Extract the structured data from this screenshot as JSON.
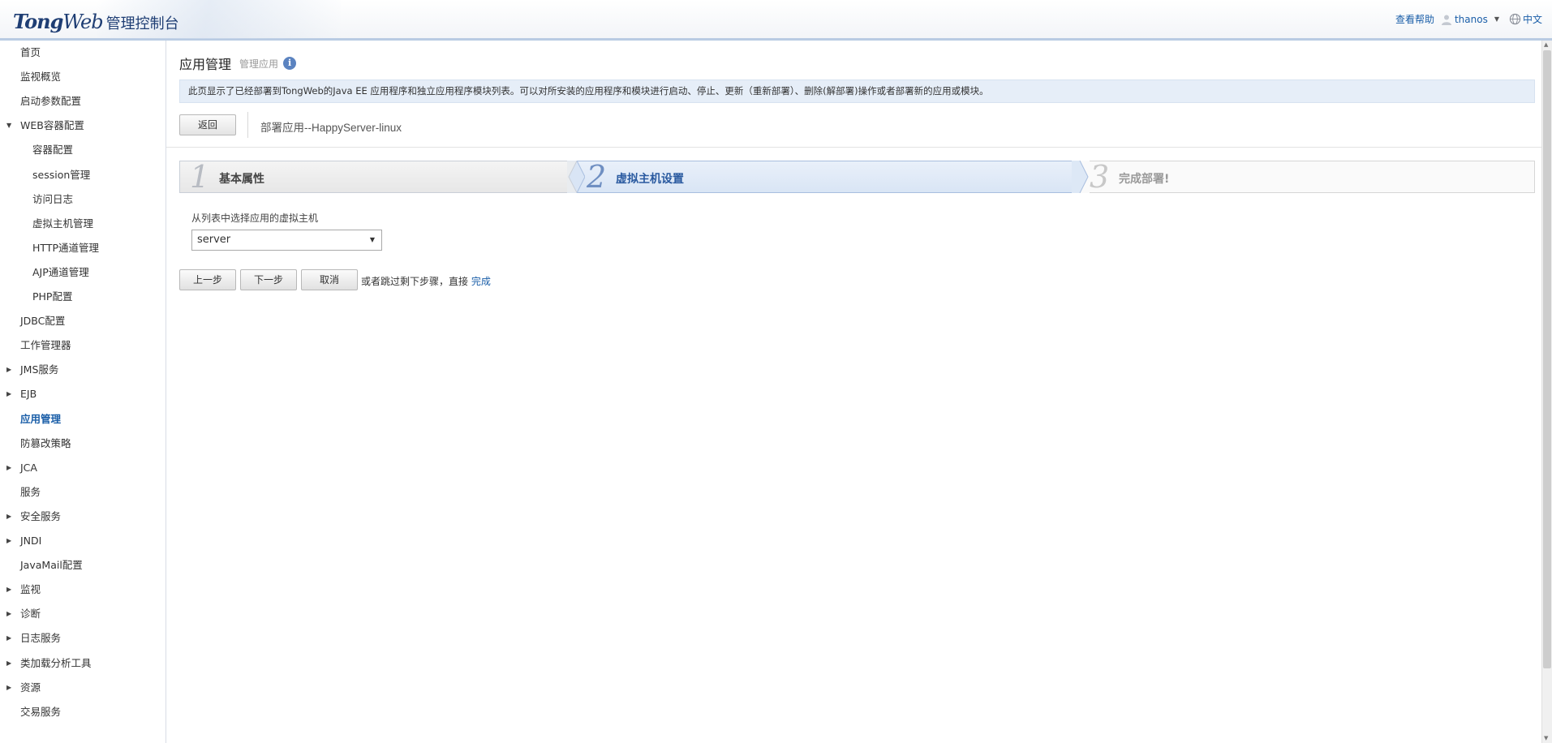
{
  "header": {
    "logo_brand_a": "Tong",
    "logo_brand_b": "Web",
    "logo_console": "管理控制台",
    "help": "查看帮助",
    "user": "thanos",
    "language": "中文"
  },
  "sidebar": {
    "items": [
      {
        "label": "首页",
        "level": 0,
        "expand": ""
      },
      {
        "label": "监视概览",
        "level": 0,
        "expand": ""
      },
      {
        "label": "启动参数配置",
        "level": 0,
        "expand": ""
      },
      {
        "label": "WEB容器配置",
        "level": 0,
        "expand": "▼"
      },
      {
        "label": "容器配置",
        "level": 1,
        "expand": ""
      },
      {
        "label": "session管理",
        "level": 1,
        "expand": ""
      },
      {
        "label": "访问日志",
        "level": 1,
        "expand": ""
      },
      {
        "label": "虚拟主机管理",
        "level": 1,
        "expand": ""
      },
      {
        "label": "HTTP通道管理",
        "level": 1,
        "expand": ""
      },
      {
        "label": "AJP通道管理",
        "level": 1,
        "expand": ""
      },
      {
        "label": "PHP配置",
        "level": 1,
        "expand": ""
      },
      {
        "label": "JDBC配置",
        "level": 0,
        "expand": ""
      },
      {
        "label": "工作管理器",
        "level": 0,
        "expand": ""
      },
      {
        "label": "JMS服务",
        "level": 0,
        "expand": "▶"
      },
      {
        "label": "EJB",
        "level": 0,
        "expand": "▶"
      },
      {
        "label": "应用管理",
        "level": 0,
        "expand": "",
        "active": true
      },
      {
        "label": "防篡改策略",
        "level": 0,
        "expand": ""
      },
      {
        "label": "JCA",
        "level": 0,
        "expand": "▶"
      },
      {
        "label": "服务",
        "level": 0,
        "expand": ""
      },
      {
        "label": "安全服务",
        "level": 0,
        "expand": "▶"
      },
      {
        "label": "JNDI",
        "level": 0,
        "expand": "▶"
      },
      {
        "label": "JavaMail配置",
        "level": 0,
        "expand": ""
      },
      {
        "label": "监视",
        "level": 0,
        "expand": "▶"
      },
      {
        "label": "诊断",
        "level": 0,
        "expand": "▶"
      },
      {
        "label": "日志服务",
        "level": 0,
        "expand": "▶"
      },
      {
        "label": "类加载分析工具",
        "level": 0,
        "expand": "▶"
      },
      {
        "label": "资源",
        "level": 0,
        "expand": "▶"
      },
      {
        "label": "交易服务",
        "level": 0,
        "expand": ""
      }
    ]
  },
  "main": {
    "title": "应用管理",
    "subtitle": "管理应用",
    "info_glyph": "i",
    "description": "此页显示了已经部署到TongWeb的Java EE 应用程序和独立应用程序模块列表。可以对所安装的应用程序和模块进行启动、停止、更新（重新部署）、删除(解部署)操作或者部署新的应用或模块。",
    "back_label": "返回",
    "deploy_title": "部署应用--HappyServer-linux",
    "steps": [
      {
        "num": "1",
        "label": "基本属性",
        "state": "done"
      },
      {
        "num": "2",
        "label": "虚拟主机设置",
        "state": "current"
      },
      {
        "num": "3",
        "label": "完成部署!",
        "state": "pending"
      }
    ],
    "vhost_label": "从列表中选择应用的虚拟主机",
    "vhost_value": "server",
    "prev_label": "上一步",
    "next_label": "下一步",
    "cancel_label": "取消",
    "skip_text": "或者跳过剩下步骤，直接",
    "finish_link": "完成"
  },
  "colors": {
    "accent": "#1a5ea8",
    "header_border": "#b9cbe3",
    "desc_bg": "#e6eef8",
    "step_current_bg": "#d9e5f5"
  }
}
